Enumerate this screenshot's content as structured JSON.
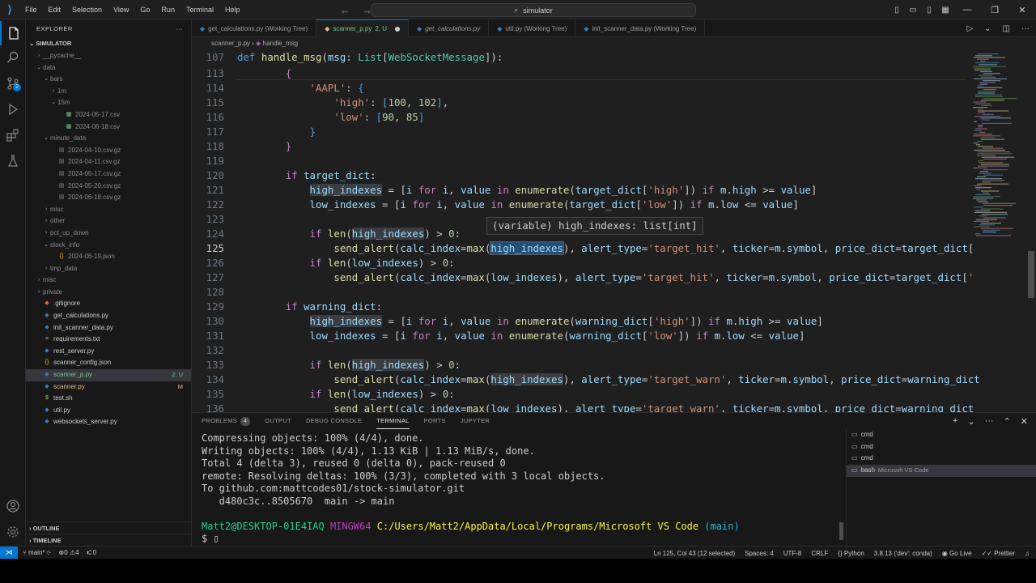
{
  "titlebar": {
    "menu": [
      "File",
      "Edit",
      "Selection",
      "View",
      "Go",
      "Run",
      "Terminal",
      "Help"
    ],
    "search": "simulator"
  },
  "explorer": {
    "header": "EXPLORER",
    "root": "SIMULATOR",
    "items": [
      {
        "label": "__pycache__",
        "depth": 1,
        "type": "folder",
        "open": false,
        "status": "",
        "color": "dim"
      },
      {
        "label": "data",
        "depth": 1,
        "type": "folder",
        "open": true,
        "status": "",
        "color": "dim"
      },
      {
        "label": "bars",
        "depth": 2,
        "type": "folder",
        "open": true,
        "status": "",
        "color": "dim"
      },
      {
        "label": "1m",
        "depth": 3,
        "type": "folder",
        "open": false,
        "status": "",
        "color": "dim"
      },
      {
        "label": "15m",
        "depth": 3,
        "type": "folder",
        "open": true,
        "status": "",
        "color": "dim"
      },
      {
        "label": "2024-05-17.csv",
        "depth": 4,
        "type": "csv",
        "status": "",
        "color": "dim"
      },
      {
        "label": "2024-06-18.csv",
        "depth": 4,
        "type": "csv",
        "status": "",
        "color": "dim"
      },
      {
        "label": "minute_data",
        "depth": 2,
        "type": "folder",
        "open": true,
        "status": "",
        "color": "dim"
      },
      {
        "label": "2024-04-10.csv.gz",
        "depth": 3,
        "type": "gz",
        "status": "",
        "color": "dim"
      },
      {
        "label": "2024-04-11.csv.gz",
        "depth": 3,
        "type": "gz",
        "status": "",
        "color": "dim"
      },
      {
        "label": "2024-05-17.csv.gz",
        "depth": 3,
        "type": "gz",
        "status": "",
        "color": "dim"
      },
      {
        "label": "2024-05-20.csv.gz",
        "depth": 3,
        "type": "gz",
        "status": "",
        "color": "dim"
      },
      {
        "label": "2024-06-18.csv.gz",
        "depth": 3,
        "type": "gz",
        "status": "",
        "color": "dim"
      },
      {
        "label": "misc",
        "depth": 2,
        "type": "folder",
        "open": false,
        "status": "",
        "color": "dim"
      },
      {
        "label": "other",
        "depth": 2,
        "type": "folder",
        "open": false,
        "status": "",
        "color": "dim"
      },
      {
        "label": "pct_up_down",
        "depth": 2,
        "type": "folder",
        "open": false,
        "status": "",
        "color": "dim"
      },
      {
        "label": "stock_info",
        "depth": 2,
        "type": "folder",
        "open": true,
        "status": "",
        "color": "dim"
      },
      {
        "label": "2024-06-19.json",
        "depth": 3,
        "type": "json",
        "status": "",
        "color": "dim"
      },
      {
        "label": "tmp_data",
        "depth": 2,
        "type": "folder",
        "open": false,
        "status": "",
        "color": "dim"
      },
      {
        "label": "misc",
        "depth": 1,
        "type": "folder",
        "open": false,
        "status": "",
        "color": "dim"
      },
      {
        "label": "private",
        "depth": 1,
        "type": "folder",
        "open": false,
        "status": "",
        "color": "dim"
      },
      {
        "label": ".gitignore",
        "depth": 1,
        "type": "git",
        "status": "",
        "color": "norm"
      },
      {
        "label": "get_calculations.py",
        "depth": 1,
        "type": "py",
        "status": "",
        "color": "norm"
      },
      {
        "label": "init_scanner_data.py",
        "depth": 1,
        "type": "py",
        "status": "",
        "color": "norm"
      },
      {
        "label": "requirements.txt",
        "depth": 1,
        "type": "txt",
        "status": "",
        "color": "norm"
      },
      {
        "label": "rest_server.py",
        "depth": 1,
        "type": "py",
        "status": "",
        "color": "norm"
      },
      {
        "label": "scanner_config.json",
        "depth": 1,
        "type": "json",
        "status": "",
        "color": "norm"
      },
      {
        "label": "scanner_p.py",
        "depth": 1,
        "type": "py",
        "status": "2, U",
        "color": "unt",
        "selected": true
      },
      {
        "label": "scanner.py",
        "depth": 1,
        "type": "py",
        "status": "M",
        "color": "mod"
      },
      {
        "label": "test.sh",
        "depth": 1,
        "type": "sh",
        "status": "",
        "color": "norm"
      },
      {
        "label": "util.py",
        "depth": 1,
        "type": "py",
        "status": "",
        "color": "norm"
      },
      {
        "label": "websockets_server.py",
        "depth": 1,
        "type": "py",
        "status": "",
        "color": "norm"
      }
    ],
    "outline": "OUTLINE",
    "timeline": "TIMELINE"
  },
  "tabs": [
    {
      "label": "get_calculations.py (Working Tree)",
      "active": false,
      "extra": ""
    },
    {
      "label": "scanner_p.py",
      "active": true,
      "extra": "2, U"
    },
    {
      "label": "get_calculations.py",
      "active": false,
      "extra": ""
    },
    {
      "label": "util.py (Working Tree)",
      "active": false,
      "extra": ""
    },
    {
      "label": "init_scanner_data.py (Working Tree)",
      "active": false,
      "extra": ""
    }
  ],
  "breadcrumb": {
    "file": "scanner_p.py",
    "symbol": "handle_msg"
  },
  "editor": {
    "line_numbers": [
      "107",
      "113",
      "114",
      "115",
      "116",
      "117",
      "118",
      "119",
      "120",
      "121",
      "122",
      "123",
      "124",
      "125",
      "126",
      "127",
      "128",
      "129",
      "130",
      "131",
      "132",
      "133",
      "134",
      "135",
      "136"
    ],
    "current_line": "125",
    "tooltip": "(variable) high_indexes: list[int]"
  },
  "panel": {
    "tabs": [
      {
        "label": "PROBLEMS",
        "count": "4"
      },
      {
        "label": "OUTPUT"
      },
      {
        "label": "DEBUG CONSOLE"
      },
      {
        "label": "TERMINAL",
        "active": true
      },
      {
        "label": "PORTS"
      },
      {
        "label": "JUPYTER"
      }
    ],
    "terminal_lines": [
      "Compressing objects: 100% (4/4), done.",
      "Writing objects: 100% (4/4), 1.13 KiB | 1.13 MiB/s, done.",
      "Total 4 (delta 3), reused 0 (delta 0), pack-reused 0",
      "remote: Resolving deltas: 100% (3/3), completed with 3 local objects.",
      "To github.com:mattcodes01/stock-simulator.git",
      "   d480c3c..8505670  main -> main",
      ""
    ],
    "prompt": {
      "user": "Matt2@DESKTOP-01E4IAQ",
      "shell": "MINGW64",
      "path": "C:/Users/Matt2/AppData/Local/Programs/Microsoft VS Code",
      "branch": "(main)",
      "symbol": "$"
    },
    "terminals": [
      {
        "name": "cmd",
        "sub": ""
      },
      {
        "name": "cmd",
        "sub": ""
      },
      {
        "name": "cmd",
        "sub": ""
      },
      {
        "name": "bash",
        "sub": "Microsoft VS Code"
      }
    ]
  },
  "statusbar": {
    "branch": "main*",
    "errors": "0",
    "warnings": "4",
    "ports": "0",
    "position": "Ln 125, Col 43 (12 selected)",
    "spaces": "Spaces: 4",
    "encoding": "UTF-8",
    "eol": "CRLF",
    "language": "Python",
    "interpreter": "3.8.13 ('dev': conda)",
    "golive": "Go Live",
    "prettier": "Prettier"
  }
}
